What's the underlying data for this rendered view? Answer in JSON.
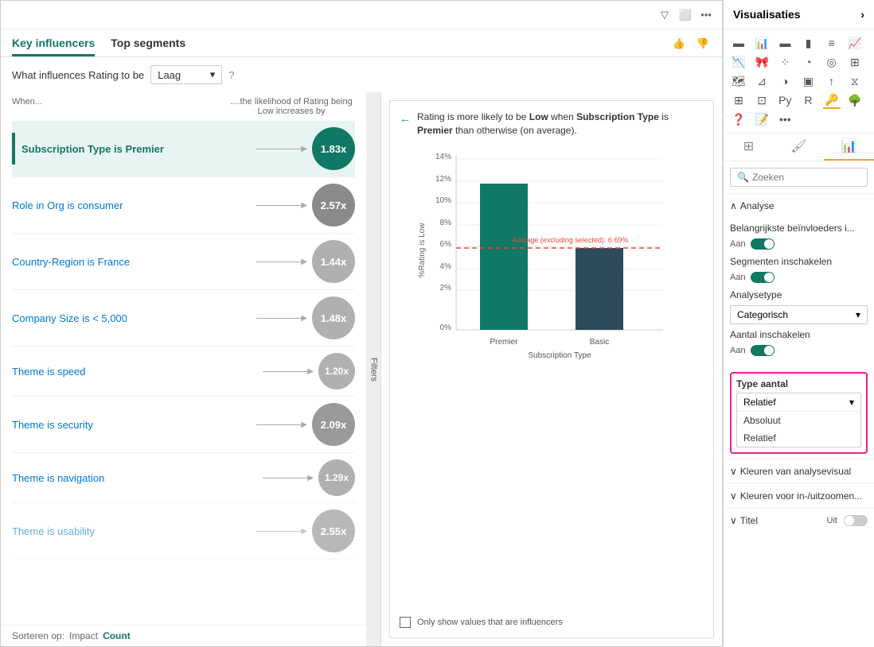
{
  "mainPanel": {
    "topIcons": [
      "filter-icon",
      "expand-icon",
      "more-icon"
    ],
    "tabs": [
      {
        "id": "key-influencers",
        "label": "Key influencers",
        "active": true
      },
      {
        "id": "top-segments",
        "label": "Top segments",
        "active": false
      }
    ],
    "tabIcons": [
      "thumbs-up-icon",
      "thumbs-down-icon"
    ],
    "filterRow": {
      "label": "What influences Rating to be",
      "dropdownValue": "Laag",
      "helpIcon": "?"
    },
    "columnHeaders": {
      "when": "When...",
      "likelihood": "....the likelihood of Rating being Low increases by"
    },
    "influencers": [
      {
        "id": 1,
        "label": "Subscription Type is Premier",
        "value": "1.83x",
        "bubbleType": "teal",
        "selected": true
      },
      {
        "id": 2,
        "label": "Role in Org is consumer",
        "value": "2.57x",
        "bubbleType": "gray"
      },
      {
        "id": 3,
        "label": "Country-Region is France",
        "value": "1.44x",
        "bubbleType": "gray-light"
      },
      {
        "id": 4,
        "label": "Company Size is < 5,000",
        "value": "1.48x",
        "bubbleType": "gray-light"
      },
      {
        "id": 5,
        "label": "Theme is speed",
        "value": "1.20x",
        "bubbleType": "gray-light"
      },
      {
        "id": 6,
        "label": "Theme is security",
        "value": "2.09x",
        "bubbleType": "gray"
      },
      {
        "id": 7,
        "label": "Theme is navigation",
        "value": "1.29x",
        "bubbleType": "gray-light"
      },
      {
        "id": 8,
        "label": "Theme is usability",
        "value": "2.55x",
        "bubbleType": "gray"
      }
    ],
    "sortBar": {
      "label": "Sorteren op:",
      "options": [
        {
          "id": "impact",
          "label": "Impact",
          "active": false
        },
        {
          "id": "count",
          "label": "Count",
          "active": true
        }
      ]
    }
  },
  "detailPanel": {
    "backArrow": "←",
    "titleParts": {
      "prefix": "Rating is more likely to be ",
      "highlight1": "Low",
      "mid": " when ",
      "highlight2": "Subscription Type",
      "suffix": " is ",
      "highlight3": "Premier",
      "end": " than otherwise (on average)."
    },
    "titleFull": "Rating is more likely to be Low when Subscription Type is Premier than otherwise (on average).",
    "chart": {
      "yAxisLabel": "%Rating is Low",
      "yTicks": [
        "14%",
        "12%",
        "10%",
        "8%",
        "6%",
        "4%",
        "2%",
        "0%"
      ],
      "xAxisLabel": "Subscription Type",
      "bars": [
        {
          "id": "premier",
          "label": "Premier",
          "value": 12.5,
          "color": "#117865",
          "heightPct": 89
        },
        {
          "id": "basic",
          "label": "Basic",
          "value": 6.69,
          "color": "#2d4a5a",
          "heightPct": 48
        }
      ],
      "averageLine": {
        "label": "Average (excluding selected): 6.69%",
        "value": 6.69,
        "color": "#e74c3c",
        "yPct": 52
      }
    },
    "checkbox": {
      "checked": false,
      "label": "Only show values that are influencers"
    }
  },
  "sidebar": {
    "title": "Visualisaties",
    "vizIcons": [
      "bar-chart-icon",
      "column-chart-icon",
      "stacked-bar-icon",
      "stacked-col-icon",
      "clustered-bar-icon",
      "clustered-col-icon",
      "line-chart-icon",
      "area-chart-icon",
      "ribbon-chart-icon",
      "waterfall-icon",
      "scatter-icon",
      "pie-icon",
      "donut-icon",
      "treemap-icon",
      "map-icon",
      "filled-map-icon",
      "funnel-icon",
      "gauge-icon",
      "card-icon",
      "kpi-icon",
      "slicer-icon",
      "table-icon",
      "matrix-icon",
      "r-visual-icon",
      "key-influencers-icon",
      "decomp-tree-icon",
      "qna-icon",
      "smart-narrative-icon",
      "more-icons"
    ],
    "tabIcons": [
      {
        "id": "fields",
        "icon": "⊞",
        "active": false
      },
      {
        "id": "format",
        "icon": "🖌",
        "active": false
      },
      {
        "id": "analytics",
        "icon": "📊",
        "active": true
      }
    ],
    "search": {
      "placeholder": "Zoeken"
    },
    "sections": {
      "analyse": {
        "label": "Analyse",
        "open": true,
        "items": [
          {
            "id": "belangrijkste",
            "label": "Belangrijkste beïnvloeders i...",
            "toggle": {
              "label": "Aan",
              "on": true
            }
          },
          {
            "id": "segmenten",
            "label": "Segmenten inschakelen",
            "toggle": {
              "label": "Aan",
              "on": true
            }
          },
          {
            "id": "analysetype",
            "label": "Analysetype",
            "dropdown": {
              "value": "Categorisch"
            }
          },
          {
            "id": "aantal-inschakelen",
            "label": "Aantal inschakelen",
            "toggle": {
              "label": "Aan",
              "on": true
            }
          }
        ]
      },
      "typeAantal": {
        "label": "Type aantal",
        "highlighted": true,
        "dropdown": {
          "value": "Relatief",
          "options": [
            "Absoluut",
            "Relatief"
          ]
        }
      },
      "kleurenAnalyse": {
        "label": "Kleuren van analysevisual",
        "open": false
      },
      "kleurenInUit": {
        "label": "Kleuren voor in-/uitzoomen...",
        "open": false
      },
      "titel": {
        "label": "Titel",
        "toggle": {
          "label": "Uit",
          "on": false
        }
      }
    }
  }
}
